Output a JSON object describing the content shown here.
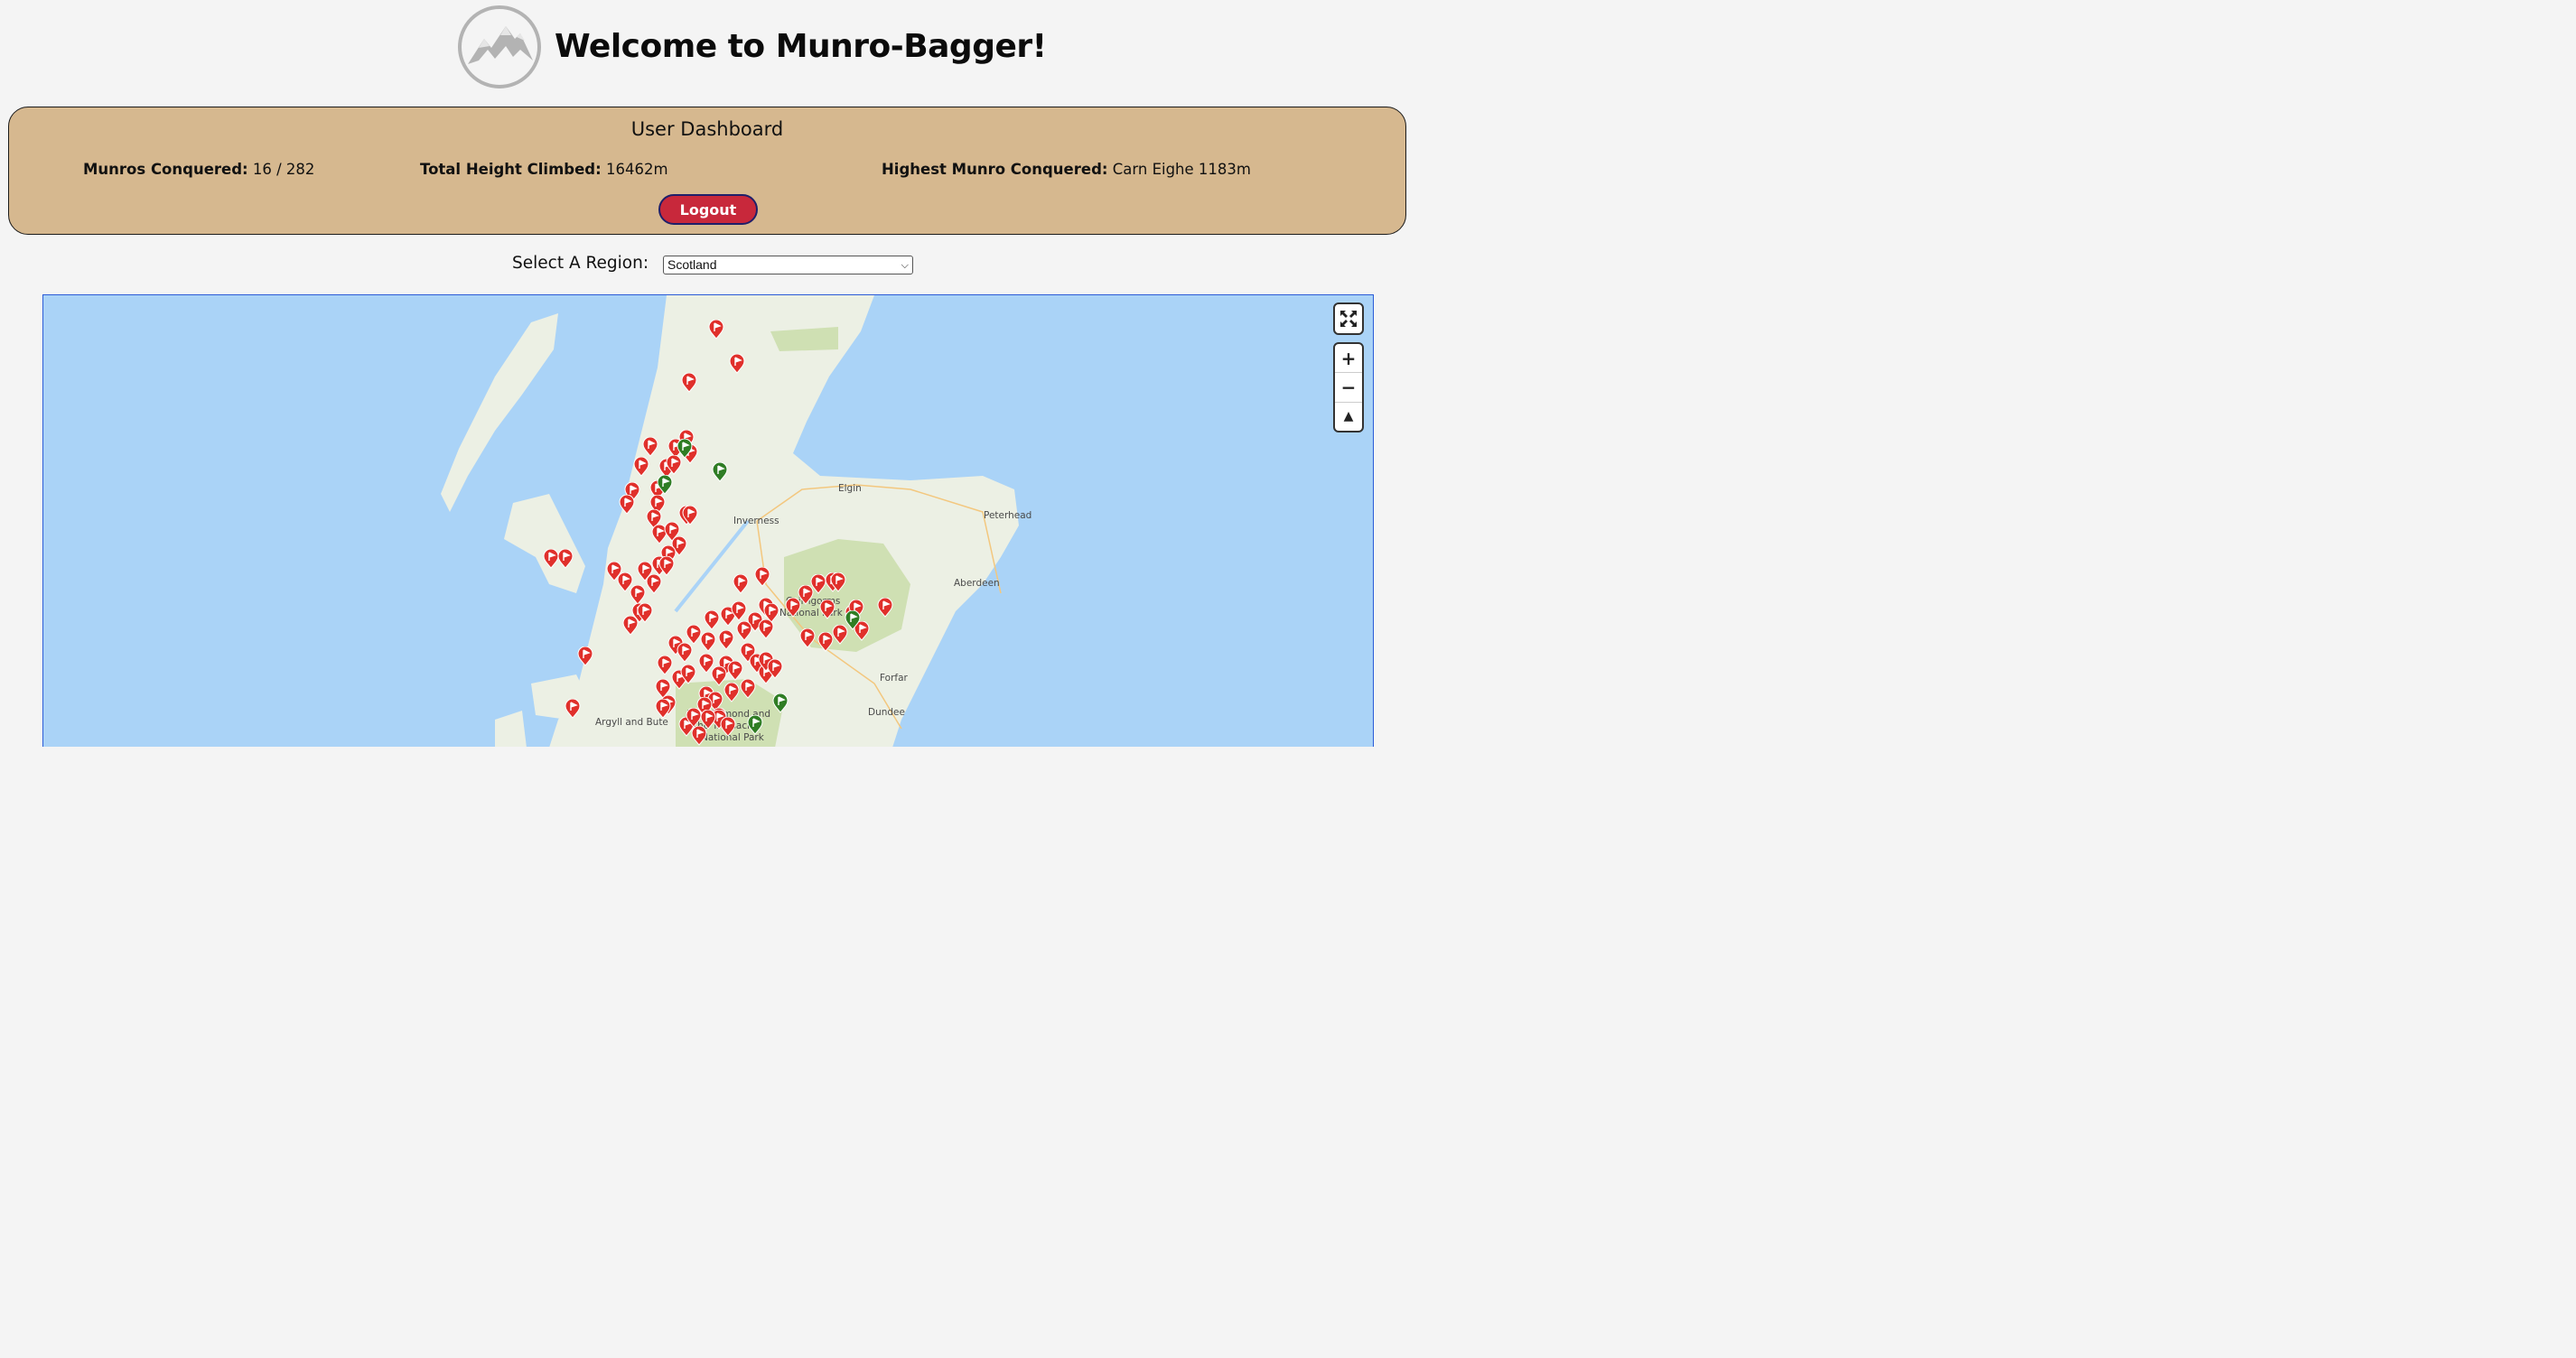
{
  "header": {
    "title": "Welcome to Munro-Bagger!",
    "logo_icon": "mountain-logo-icon"
  },
  "dashboard": {
    "title": "User Dashboard",
    "munros_label": "Munros Conquered:",
    "munros_value": "16 / 282",
    "height_label": "Total Height Climbed:",
    "height_value": "16462m",
    "highest_label": "Highest Munro Conquered:",
    "highest_value": "Carn Eighe 1183m",
    "logout_label": "Logout"
  },
  "region": {
    "label": "Select A Region:",
    "selected": "Scotland"
  },
  "map": {
    "labels": {
      "elgin": "Elgin",
      "inverness": "Inverness",
      "peterhead": "Peterhead",
      "aberdeen": "Aberdeen",
      "cairngorms_1": "Cairngorms",
      "cairngorms_2": "National Park",
      "forfar": "Forfar",
      "dundee": "Dundee",
      "argyll": "Argyll and Bute",
      "lochlomond_1": "Loch Lomond and",
      "lochlomond_2": "the Trossachs",
      "lochlomond_3": "National Park"
    },
    "controls": {
      "fullscreen_icon": "fullscreen-icon",
      "zoom_in": "+",
      "zoom_out": "−",
      "compass": "▲"
    },
    "colors": {
      "water": "#aad3f7",
      "land": "#ecf0e4",
      "park": "#cfe0b3",
      "unclimbed_pin": "#e0302b",
      "climbed_pin": "#2f7d24"
    }
  }
}
